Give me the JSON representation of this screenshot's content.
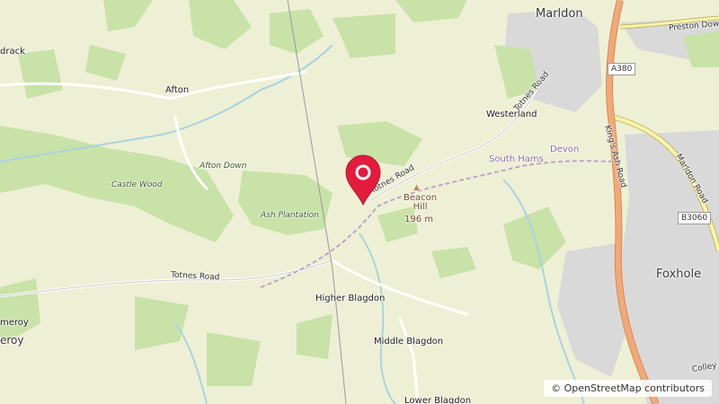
{
  "places": {
    "marldon": "Marldon",
    "afton": "Afton",
    "afton_down": "Afton Down",
    "castle_wood": "Castle Wood",
    "ash_plantation": "Ash Plantation",
    "westerland": "Westerland",
    "beacon_hill": "Beacon\nHill",
    "beacon_hill_elevation": "196 m",
    "higher_blagdon": "Higher Blagdon",
    "middle_blagdon": "Middle Blagdon",
    "lower_blagdon": "Lower Blagdon",
    "foxhole": "Foxhole",
    "partial_left_top": "drack",
    "partial_left_1": "meroy",
    "partial_left_2": "eroy",
    "region_south_hams": "South Hams",
    "region_devon": "Devon"
  },
  "roads": {
    "totnes_road_a": "Totnes Road",
    "totnes_road_b": "Totnes Road",
    "totnes_road_c": "Totnes Road",
    "kings_ash_road": "King's Ash Road",
    "marldon_road": "Marldon Road",
    "preston_down": "Preston Down",
    "colley_end": "Colley E",
    "a380": "A380",
    "b3060": "B3060"
  },
  "attribution": {
    "symbol": "©",
    "text": "OpenStreetMap contributors"
  },
  "colors": {
    "land": "#eef0d5",
    "wood": "#c8e2a8",
    "urban": "#d9d9d9",
    "major_road": "#f2a97a",
    "secondary_road": "#f6f6a8",
    "water": "#aad3df",
    "marker": "#e31c3d"
  },
  "marker": {
    "icon": "map-pin-icon"
  }
}
